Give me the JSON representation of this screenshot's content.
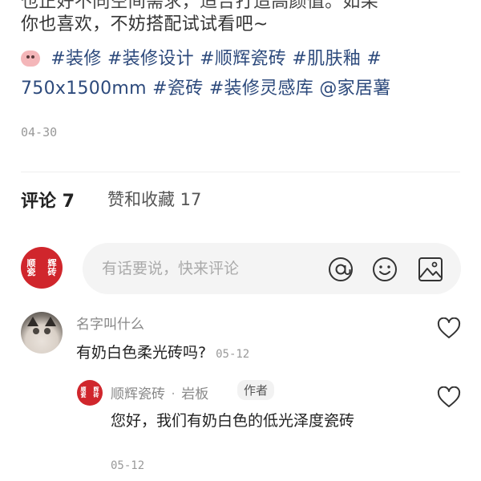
{
  "post": {
    "cut_line": "也正好不同空间需求，适合打造高颜值。如果",
    "line2": "你也喜欢，不妨搭配试试看吧~",
    "tags": [
      "#装修",
      "#装修设计",
      "#顺辉瓷砖",
      "#肌肤釉",
      "#"
    ],
    "tags_line2_size": "750x1500mm",
    "tags_line2": [
      "#瓷砖",
      "#装修灵感库"
    ],
    "mention": "@家居薯",
    "date": "04-30"
  },
  "tabs": {
    "comments": "评论 7",
    "likes": "赞和收藏 17"
  },
  "brand_logo": [
    "顺",
    "辉",
    "瓷",
    "砖"
  ],
  "comment_input": {
    "placeholder": "有话要说，快来评论"
  },
  "icons": {
    "mention": "at-icon",
    "emoji": "smiley-icon",
    "image": "image-icon",
    "like": "heart-icon"
  },
  "comments": [
    {
      "author": "名字叫什么",
      "text": "有奶白色柔光砖吗?",
      "time": "05-12",
      "reply": {
        "author": "顺辉瓷砖",
        "dot": "·",
        "author_tag": "岩板",
        "badge": "作者",
        "text": "您好，我们有奶白色的低光泽度瓷砖",
        "time": "05-12"
      }
    }
  ]
}
